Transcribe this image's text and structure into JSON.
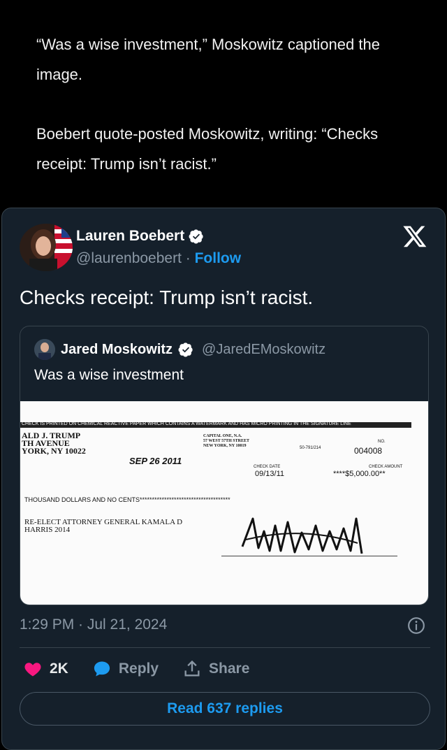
{
  "article": {
    "para1": "“Was a wise investment,” Moskowitz captioned the image.",
    "para2": "Boebert quote-posted Moskowitz, writing: “Checks receipt: Trump isn’t racist.”"
  },
  "tweet": {
    "author_name": "Lauren Boebert",
    "author_handle": "@laurenboebert",
    "separator": " · ",
    "follow_label": "Follow",
    "text": "Checks receipt: Trump isn’t racist.",
    "timestamp": "1:29 PM · Jul 21, 2024",
    "likes": "2K",
    "reply_label": "Reply",
    "share_label": "Share",
    "read_replies_label": "Read 637 replies"
  },
  "quote": {
    "author_name": "Jared Moskowitz",
    "author_handle": "@JaredEMoskowitz",
    "text": "Was a wise investment"
  },
  "check": {
    "security_bar": "CHECK IS PRINTED ON CHEMICAL REACTIVE PAPER WHICH CONTAINS A WATERMARK AND HAS MICRO PRINTING IN THE SIGNATURE LINE",
    "payer_line1": "ALD J. TRUMP",
    "payer_line2": "TH AVENUE",
    "payer_line3": "YORK, NY 10022",
    "bank_line1": "CAPITAL ONE, N.A.",
    "bank_line2": "57 WEST 57TH STREET",
    "bank_line3": "NEW YORK, NY 10019",
    "routing": "50-791/214",
    "no_label": "NO.",
    "check_number": "004008",
    "handwritten_date": "SEP 26 2011",
    "check_date_label": "CHECK DATE",
    "check_date": "09/13/11",
    "check_amount_label": "CHECK AMOUNT",
    "check_amount": "****$5,000.00**",
    "amount_words": "THOUSAND DOLLARS AND NO CENTS*************************************",
    "payee_line1": "RE-ELECT ATTORNEY GENERAL KAMALA D",
    "payee_line2": "HARRIS 2014"
  },
  "colors": {
    "accent": "#1d9bf0",
    "card_bg": "#15202b",
    "like": "#f91880"
  }
}
